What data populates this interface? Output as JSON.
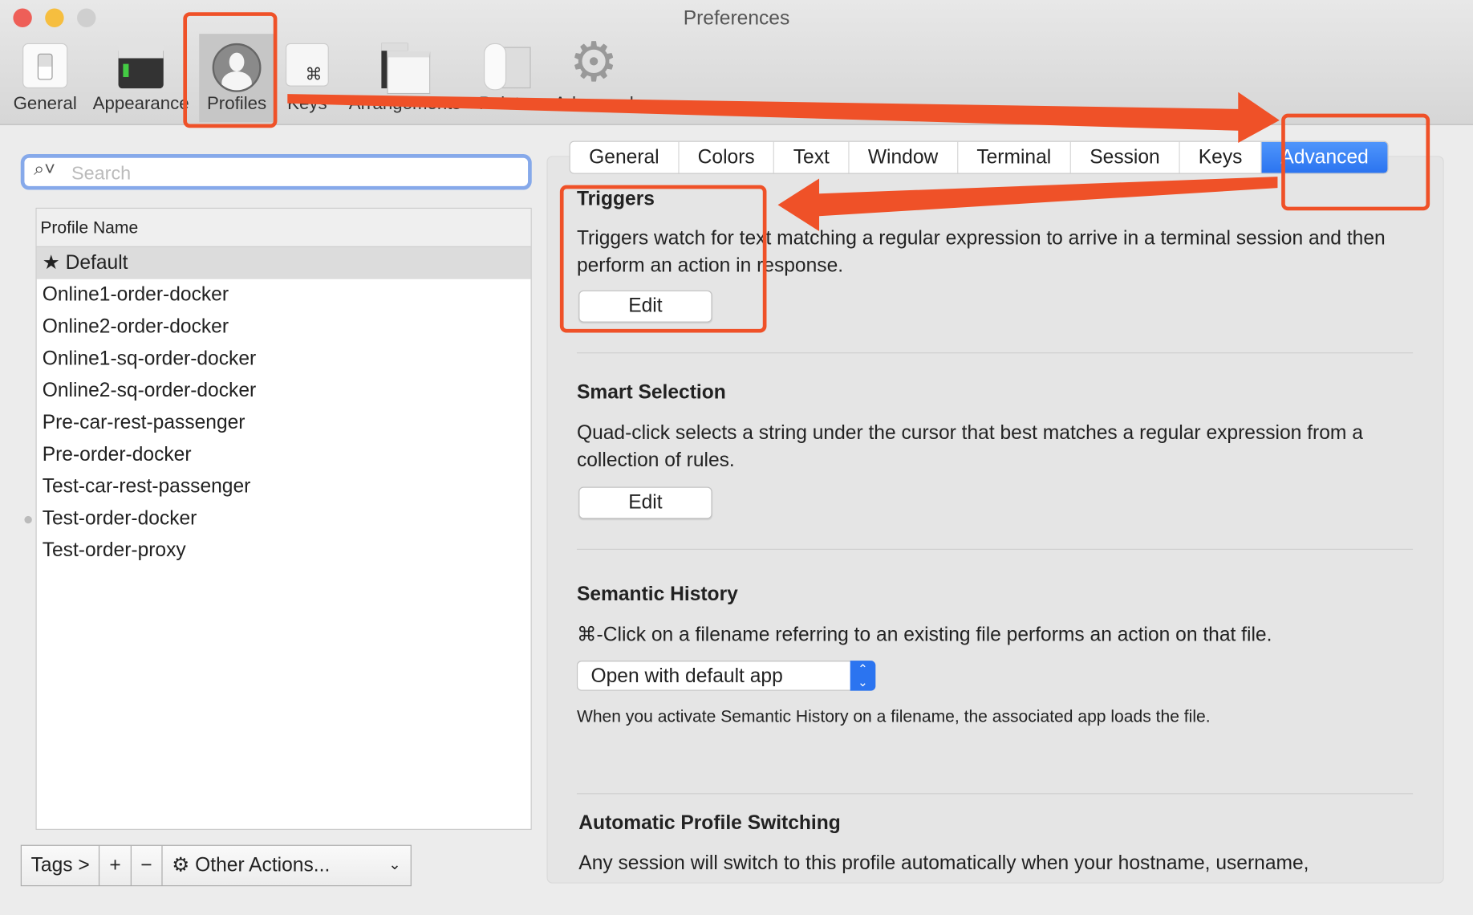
{
  "window": {
    "title": "Preferences"
  },
  "toolbar": {
    "items": [
      {
        "label": "General"
      },
      {
        "label": "Appearance"
      },
      {
        "label": "Profiles"
      },
      {
        "label": "Keys"
      },
      {
        "label": "Arrangements"
      },
      {
        "label": "Pointer"
      },
      {
        "label": "Advanced"
      }
    ],
    "selected": "Profiles"
  },
  "sidebar": {
    "search_placeholder": "Search",
    "column_header": "Profile Name",
    "profiles": [
      {
        "name": "Default",
        "default": true
      },
      {
        "name": "Online1-order-docker"
      },
      {
        "name": "Online2-order-docker"
      },
      {
        "name": "Online1-sq-order-docker"
      },
      {
        "name": "Online2-sq-order-docker"
      },
      {
        "name": "Pre-car-rest-passenger"
      },
      {
        "name": "Pre-order-docker"
      },
      {
        "name": "Test-car-rest-passenger"
      },
      {
        "name": "Test-order-docker"
      },
      {
        "name": "Test-order-proxy"
      }
    ],
    "tags_label": "Tags >",
    "add_label": "+",
    "remove_label": "−",
    "other_actions_label": "Other Actions..."
  },
  "tabs": [
    {
      "label": "General"
    },
    {
      "label": "Colors"
    },
    {
      "label": "Text"
    },
    {
      "label": "Window"
    },
    {
      "label": "Terminal"
    },
    {
      "label": "Session"
    },
    {
      "label": "Keys"
    },
    {
      "label": "Advanced"
    }
  ],
  "active_tab": "Advanced",
  "advanced": {
    "triggers": {
      "title": "Triggers",
      "desc": "Triggers watch for text matching a regular expression to arrive in a terminal session and then perform an action in response.",
      "button": "Edit"
    },
    "smart_selection": {
      "title": "Smart Selection",
      "desc": "Quad-click selects a string under the cursor that best matches a regular expression from a collection of rules.",
      "button": "Edit"
    },
    "semantic_history": {
      "title": "Semantic History",
      "desc": "⌘-Click on a filename referring to an existing file performs an action on that file.",
      "select_value": "Open with default app",
      "note": "When you activate Semantic History on a filename, the associated app loads the file."
    },
    "auto_switching": {
      "title": "Automatic Profile Switching",
      "desc": "Any session will switch to this profile automatically when your hostname, username,"
    }
  },
  "colors": {
    "accent": "#2b74f0",
    "annotation": "#ef5128"
  }
}
